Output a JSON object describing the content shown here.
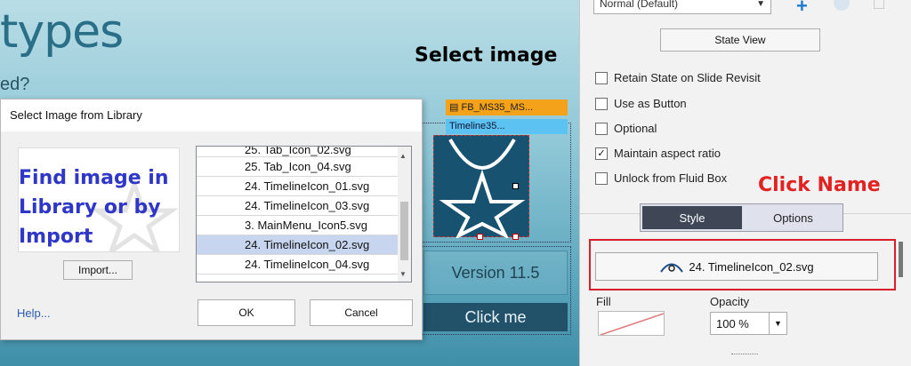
{
  "slide": {
    "title_fragment": "types",
    "subtitle_fragment": "ed?",
    "annotation_select": "Select image",
    "tag_orange": "FB_MS35_MS...",
    "tag_blue": "Timeline35...",
    "version_text": "Version 11.5",
    "clickme_text": "Click me"
  },
  "dialog": {
    "title": "Select Image from Library",
    "preview_text": "Find image in Library or by Import",
    "import_label": "Import...",
    "list_items": [
      {
        "label": "25. Tab_Icon_02.svg",
        "selected": false,
        "partial": true
      },
      {
        "label": "25. Tab_Icon_04.svg",
        "selected": false
      },
      {
        "label": "24. TimelineIcon_01.svg",
        "selected": false
      },
      {
        "label": "24. TimelineIcon_03.svg",
        "selected": false
      },
      {
        "label": "3. MainMenu_Icon5.svg",
        "selected": false
      },
      {
        "label": "24. TimelineIcon_02.svg",
        "selected": true
      },
      {
        "label": "24. TimelineIcon_04.svg",
        "selected": false
      }
    ],
    "help_label": "Help...",
    "ok_label": "OK",
    "cancel_label": "Cancel"
  },
  "panel": {
    "state_select": "Normal (Default)",
    "state_view_label": "State View",
    "checkboxes": [
      {
        "label": "Retain State on Slide Revisit",
        "checked": false
      },
      {
        "label": "Use as Button",
        "checked": false
      },
      {
        "label": "Optional",
        "checked": false
      },
      {
        "label": "Maintain aspect ratio",
        "checked": true
      },
      {
        "label": "Unlock from Fluid Box",
        "checked": false
      }
    ],
    "annotation_click_name": "Click Name",
    "tab_style": "Style",
    "tab_options": "Options",
    "image_name_button": "24. TimelineIcon_02.svg",
    "fill_label": "Fill",
    "opacity_label": "Opacity",
    "opacity_value": "100 %"
  },
  "colors": {
    "accent_blue": "#1f7ad2",
    "annotation_red": "#e42121",
    "tag_orange": "#f5a21b",
    "tag_blue": "#5cc2f2",
    "style_tab_active": "#3f4656"
  }
}
